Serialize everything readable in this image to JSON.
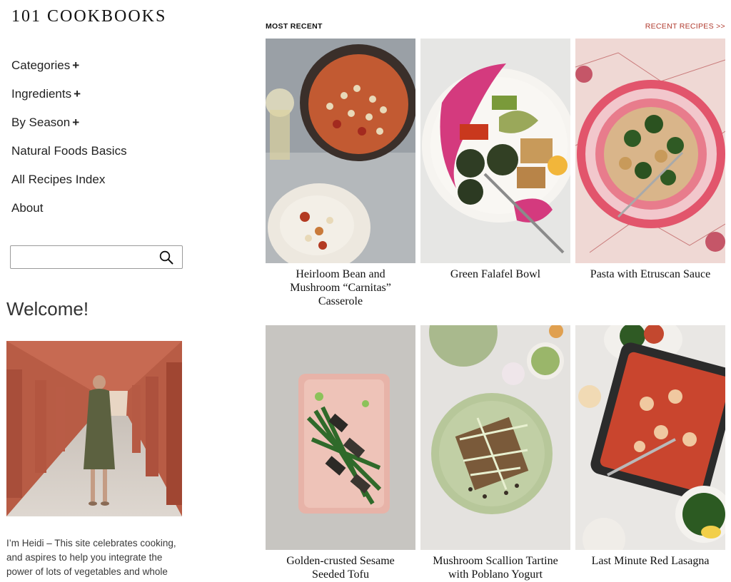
{
  "site": {
    "logo": "101 COOKBOOKS"
  },
  "nav": {
    "items": [
      {
        "label": "Categories",
        "expand": "+"
      },
      {
        "label": "Ingredients",
        "expand": "+"
      },
      {
        "label": "By Season",
        "expand": "+"
      },
      {
        "label": "Natural Foods Basics"
      },
      {
        "label": "All Recipes Index"
      },
      {
        "label": "About"
      }
    ]
  },
  "search": {
    "placeholder": "",
    "value": "",
    "icon": "search-icon"
  },
  "welcome": {
    "heading": "Welcome!",
    "intro": "I’m Heidi – This site celebrates cooking, and aspires to help you integrate the power of lots of vegetables and whole foods into your"
  },
  "main": {
    "section_label": "MOST RECENT",
    "recent_link": "RECENT RECIPES >>",
    "recipes": [
      {
        "title": "Heirloom Bean and Mushroom “Carnitas” Casserole"
      },
      {
        "title": "Green Falafel Bowl"
      },
      {
        "title": "Pasta with Etruscan Sauce"
      },
      {
        "title": "Golden-crusted Sesame Seeded Tofu"
      },
      {
        "title": "Mushroom Scallion Tartine with Poblano Yogurt"
      },
      {
        "title": "Last Minute Red Lasagna"
      }
    ]
  },
  "colors": {
    "accent": "#b03a2e",
    "text": "#1a1a1a"
  }
}
